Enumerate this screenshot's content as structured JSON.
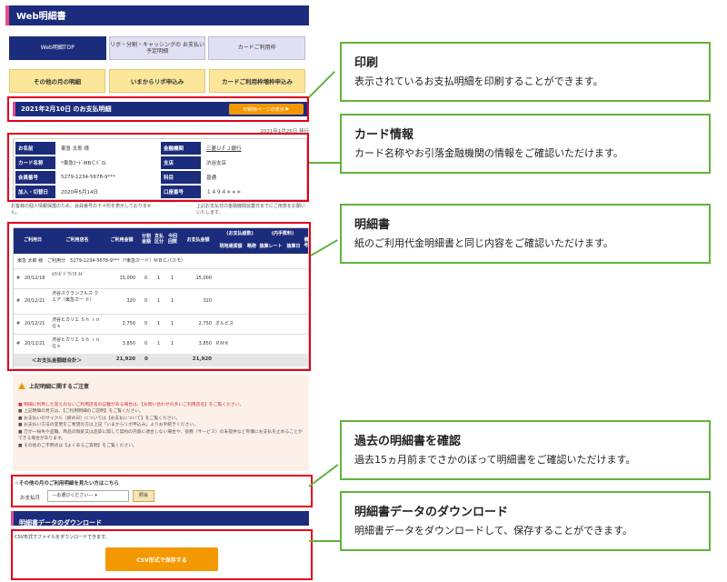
{
  "app": {
    "header": "Web明細書"
  },
  "nav": {
    "tabs": [
      {
        "label": "Web明細TOP"
      },
      {
        "label": "リボ・分割・キャッシングの お支払い予定明細"
      },
      {
        "label": "カードご利用枠"
      }
    ],
    "buttons": [
      {
        "label": "その他の月の明細"
      },
      {
        "label": "いまからリボ申込み"
      },
      {
        "label": "カードご利用枠増枠申込み"
      }
    ]
  },
  "statement_header": {
    "title": "2021年2月10日 のお支払明細",
    "print_label": "印刷用ページの表示",
    "issued": "2021年1月25日 発行"
  },
  "card_info": {
    "left": [
      {
        "label": "お名前",
        "value": "東急 太郎 様"
      },
      {
        "label": "カード名称",
        "value": "*東急ｶｰﾄﾞMBＣﾊﾞｽﾙ"
      },
      {
        "label": "会員番号",
        "value": "5279-1234-5678-9***"
      },
      {
        "label": "加入・切替日",
        "value": "2020年5月14日"
      }
    ],
    "right": [
      {
        "label": "金融機関",
        "value": "三菱ＵＦＪ銀行"
      },
      {
        "label": "支店",
        "value": "渋谷支店"
      },
      {
        "label": "科目",
        "value": "普通"
      },
      {
        "label": "口座番号",
        "value": "１４９４＊＊＊"
      }
    ],
    "note_left": "お客様の個人情報保護のため、会員番号の下４桁を表示しておりません。",
    "note_right": "上記お支払日の金融機関窓業日までにご用意をお願いいたします。"
  },
  "statement": {
    "headers": [
      "ご利用日",
      "ご利用店名",
      "ご利用金額",
      "分割 金額",
      "支払 区分",
      "今回 回数",
      "お支払金額",
      "(お支払総数)",
      "現地通貨額",
      "略称",
      "換算レート",
      "換算日",
      "(内手数料)",
      "備考"
    ],
    "owner": "東急 太郎 様　ご利用分　5279-1234-5678-9***（*東急カード）ＭＢＣパスモ）",
    "rows": [
      {
        "mark": "#",
        "date": "20/12/18",
        "store": "ﾎｸｼｶﾞﾄﾞｳｼﾗﾇ ｶﾄﾞ",
        "amount": "15,000",
        "div": "0",
        "kbn": "1",
        "cnt": "1",
        "pay": "15,000",
        "note": ""
      },
      {
        "mark": "#",
        "date": "20/12/21",
        "store": "渋谷スクランブルス クエア（東急カー ド）",
        "amount": "320",
        "div": "0",
        "kbn": "1",
        "cnt": "1",
        "pay": "320",
        "note": ""
      },
      {
        "mark": "#",
        "date": "20/12/21",
        "store": "渋谷ヒカリエ Ｓｈ ｉｎＱｓ",
        "amount": "2,750",
        "div": "0",
        "kbn": "1",
        "cnt": "1",
        "pay": "2,750",
        "note": "オルビス"
      },
      {
        "mark": "#",
        "date": "20/12/21",
        "store": "渋谷ヒカリエ Ｓｈ ｉｎＱｓ",
        "amount": "3,850",
        "div": "0",
        "kbn": "1",
        "cnt": "1",
        "pay": "3,850",
        "note": "ＲＭＫ"
      }
    ],
    "total": {
      "label": "＜お支払金額総合計＞",
      "amount": "21,920",
      "div": "0",
      "pay": "21,920"
    }
  },
  "attention": {
    "title": "上記明細に関するご注意",
    "items": [
      {
        "text": "明細に利用した覚えのないご利用店名の記載がある場合は、【お問い合わせの多いご利用店名】をご覧ください。"
      },
      {
        "text": "上記明細の見方は、【ご利用明細のご説明】をご覧ください。"
      },
      {
        "text": "お支払いのサイクル（締め日）については【お支払について】をご覧ください。"
      },
      {
        "text": "お支払い方法の変更をご希望の方は上記「いまからリボ申込み」よりお手続きください。"
      },
      {
        "text": "万が一紛失や盗難、商品の瑕疵又は品質に関して契約の内容に適合しない場合や、役務（サービス）の未提供など有償にお支払を止めることができる場合があります。"
      },
      {
        "text": "その他のご不明点は【よくあるご質問】をご覧ください。"
      }
    ]
  },
  "history": {
    "title": "☆その他の月のご利用明細を見たい方はこちら",
    "label": "お支払月",
    "select": "---お選びください---",
    "button": "照会"
  },
  "download": {
    "bar": "明細書データのダウンロード",
    "desc": "CSV形式でファイルをダウンロードできます。",
    "button": "CSV形式で保存する"
  },
  "callouts": [
    {
      "title": "印刷",
      "desc": "表示されているお支払明細を印刷することができます。"
    },
    {
      "title": "カード情報",
      "desc": "カード名称やお引落金融機関の情報をご確認いただけます。"
    },
    {
      "title": "明細書",
      "desc": "紙のご利用代金明細書と同じ内容をご確認いただけます。"
    },
    {
      "title": "過去の明細書を確認",
      "desc": "過去15ヵ月前までさかのぼって明細書をご確認いただけます。"
    },
    {
      "title": "明細書データのダウンロード",
      "desc": "明細書データをダウンロードして、保存することができます。"
    }
  ],
  "colors": {
    "navy": "#1c2c7c",
    "accent_pink": "#e84a8a",
    "highlight_red": "#e3001b",
    "callout_green": "#61b33d",
    "orange": "#f39800",
    "yellow_button": "#fbe69a"
  }
}
